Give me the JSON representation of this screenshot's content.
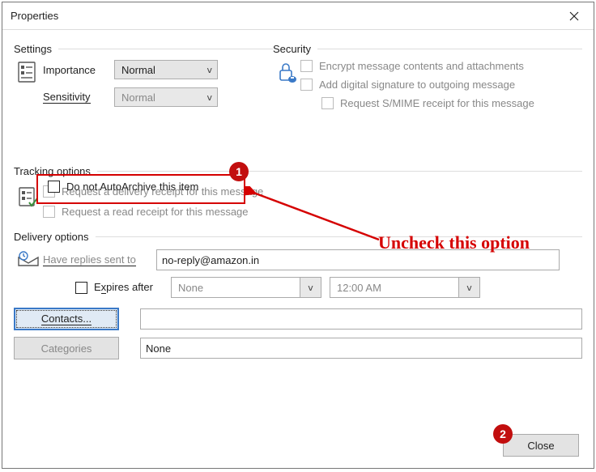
{
  "window": {
    "title": "Properties"
  },
  "settings": {
    "group_label": "Settings",
    "importance_label": "Importance",
    "importance_value": "Normal",
    "sensitivity_label": "Sensitivity",
    "sensitivity_value": "Normal",
    "autoarchive_label": "Do not AutoArchive this item"
  },
  "security": {
    "group_label": "Security",
    "encrypt_label": "Encrypt message contents and attachments",
    "signature_label": "Add digital signature to outgoing message",
    "smime_label": "Request S/MIME receipt for this message"
  },
  "tracking": {
    "group_label": "Tracking options",
    "delivery_receipt_label": "Request a delivery receipt for this message",
    "read_receipt_label": "Request a read receipt for this message"
  },
  "delivery": {
    "group_label": "Delivery options",
    "replies_label": "Have replies sent to",
    "replies_value": "no-reply@amazon.in",
    "expires_label": "Expires after",
    "expires_date": "None",
    "expires_time": "12:00 AM",
    "contacts_button": "Contacts...",
    "contacts_value": "",
    "categories_button": "Categories",
    "categories_value": "None"
  },
  "footer": {
    "close_label": "Close"
  },
  "annotation": {
    "badge1": "1",
    "badge2": "2",
    "text": "Uncheck this option"
  }
}
